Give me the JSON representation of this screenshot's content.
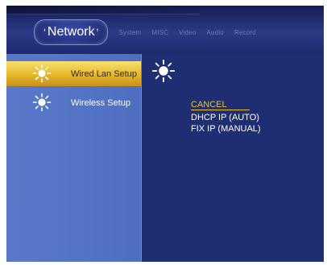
{
  "header": {
    "active_tab": "Network",
    "tabs": [
      "System",
      "MISC",
      "Video",
      "Audio",
      "Record"
    ]
  },
  "sidebar": {
    "items": [
      {
        "label": "Wired Lan Setup",
        "selected": true,
        "icon": "sun-icon"
      },
      {
        "label": "Wireless Setup",
        "selected": false,
        "icon": "sun-icon"
      }
    ]
  },
  "main": {
    "icon": "sun-icon",
    "options": [
      {
        "label": "CANCEL",
        "active": true
      },
      {
        "label": "DHCP IP (AUTO)",
        "active": false
      },
      {
        "label": "FIX IP (MANUAL)",
        "active": false
      }
    ]
  },
  "colors": {
    "background": "#1e2a6e",
    "sidebar": "#5a78c8",
    "selection": "#e6b82a",
    "active_option": "#f0c020"
  }
}
